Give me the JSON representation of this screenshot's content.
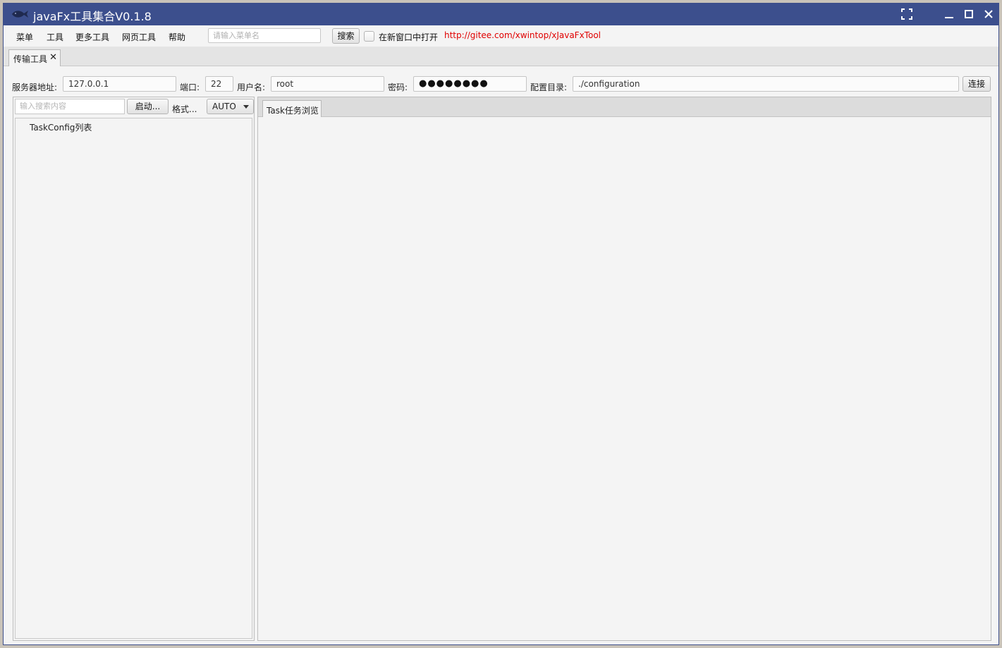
{
  "window": {
    "title": "javaFx工具集合V0.1.8",
    "icon": "fish-logo-icon",
    "controls": [
      "fullscreen-icon",
      "minimize-icon",
      "maximize-icon",
      "close-icon"
    ]
  },
  "menubar": {
    "items": [
      {
        "label": "菜单"
      },
      {
        "label": "工具"
      },
      {
        "label": "更多工具"
      },
      {
        "label": "网页工具"
      },
      {
        "label": "帮助"
      }
    ],
    "search_placeholder": "请输入菜单名",
    "search_button": "搜索",
    "new_window_label": "在新窗口中打开",
    "link": "http://gitee.com/xwintop/xJavaFxTool"
  },
  "tabs": [
    {
      "label": "传输工具",
      "close": "✕"
    }
  ],
  "connection": {
    "server_label": "服务器地址:",
    "server_value": "127.0.0.1",
    "port_label": "端口:",
    "port_value": "22",
    "user_label": "用户名:",
    "user_value": "root",
    "password_label": "密码:",
    "password_value": "●●●●●●●●",
    "config_label": "配置目录:",
    "config_value": "./configuration",
    "connect_button": "连接"
  },
  "left_panel": {
    "search_placeholder": "输入搜索内容",
    "start_button": "启动...",
    "format_label": "格式...",
    "format_value": "AUTO",
    "tree_root": "TaskConfig列表"
  },
  "right_panel": {
    "tabs": [
      {
        "label": "Task任务浏览"
      }
    ]
  },
  "colors": {
    "titlebar": "#3c4f8d",
    "link": "#e00000",
    "background": "#f4f4f4"
  }
}
